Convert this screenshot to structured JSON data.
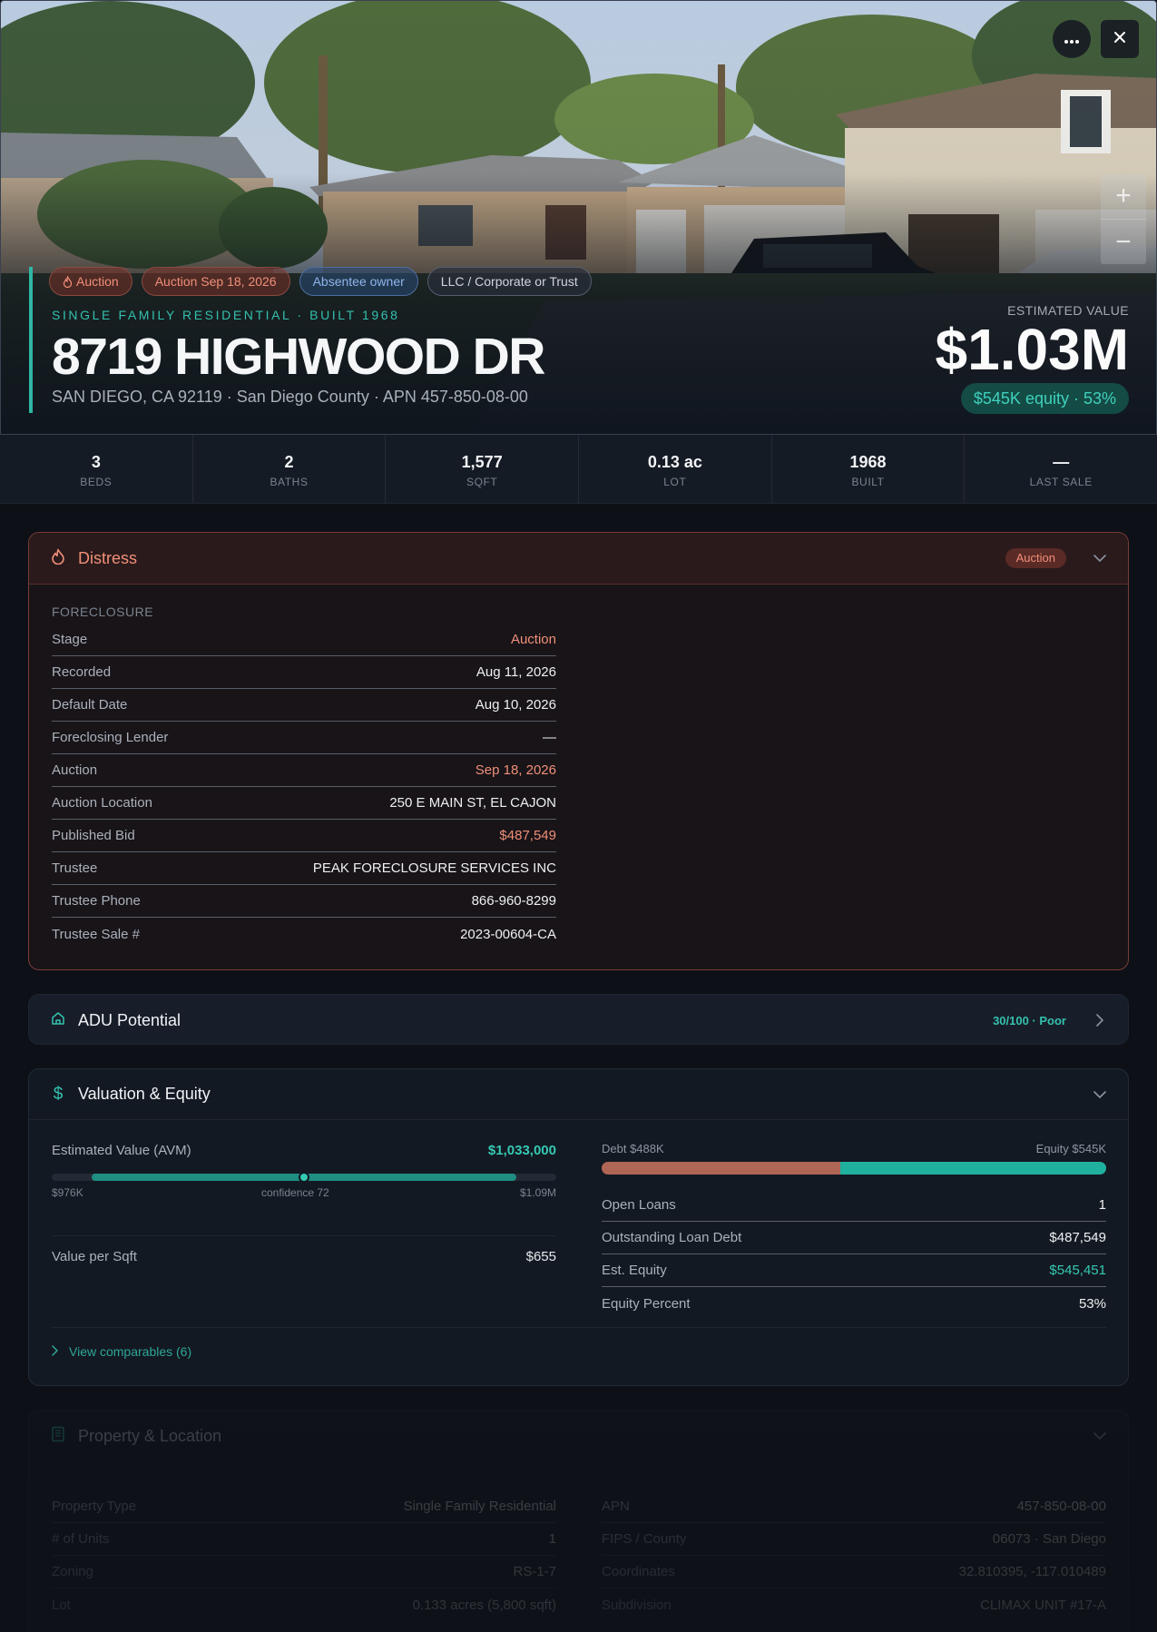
{
  "hero": {
    "tags": [
      "Auction",
      "Auction Sep 18, 2026",
      "Absentee owner",
      "LLC / Corporate or Trust"
    ],
    "type_line": "SINGLE FAMILY RESIDENTIAL · BUILT 1968",
    "address": "8719 HIGHWOOD DR",
    "sub_address": "SAN DIEGO, CA 92119 · San Diego County · APN 457-850-08-00",
    "estimated_label": "ESTIMATED VALUE",
    "estimated_value": "$1.03M",
    "equity_pill": "$545K equity · 53%",
    "more_icon": "more-horizontal-icon",
    "close_icon": "close-icon",
    "zoom_in": "+",
    "zoom_out": "−"
  },
  "stats": [
    {
      "value": "3",
      "label": "BEDS"
    },
    {
      "value": "2",
      "label": "BATHS"
    },
    {
      "value": "1,577",
      "label": "SQFT"
    },
    {
      "value": "0.13 ac",
      "label": "LOT"
    },
    {
      "value": "1968",
      "label": "BUILT"
    },
    {
      "value": "—",
      "label": "LAST SALE"
    }
  ],
  "distress": {
    "title": "Distress",
    "badge": "Auction",
    "section": "FORECLOSURE",
    "rows": [
      {
        "k": "Stage",
        "v": "Auction"
      },
      {
        "k": "Recorded",
        "v": "Aug 11, 2026"
      },
      {
        "k": "Default Date",
        "v": "Aug 10, 2026"
      },
      {
        "k": "Foreclosing Lender",
        "v": "—"
      },
      {
        "k": "Auction",
        "v": "Sep 18, 2026"
      },
      {
        "k": "Auction Location",
        "v": "250 E MAIN ST, EL CAJON"
      },
      {
        "k": "Published Bid",
        "v": "$487,549"
      },
      {
        "k": "Trustee",
        "v": "PEAK FORECLOSURE SERVICES INC"
      },
      {
        "k": "Trustee Phone",
        "v": "866-960-8299"
      },
      {
        "k": "Trustee Sale #",
        "v": "2023-00604-CA"
      }
    ]
  },
  "adu": {
    "title": "ADU Potential",
    "score": "30/100 · Poor"
  },
  "valuation": {
    "title": "Valuation & Equity",
    "avm_label": "Estimated Value (AVM)",
    "avm_value": "$1,033,000",
    "range_low": "$976K",
    "range_high": "$1.09M",
    "confidence": "confidence 72",
    "range_fill_start": 0.08,
    "range_fill_end": 0.92,
    "range_dot": 0.5,
    "vps_label": "Value per Sqft",
    "vps_value": "$655",
    "debt_label": "Debt $488K",
    "equity_label": "Equity $545K",
    "debt_fraction": 0.473,
    "rows": [
      {
        "k": "Open Loans",
        "v": "1"
      },
      {
        "k": "Outstanding Loan Debt",
        "v": "$487,549"
      },
      {
        "k": "Est. Equity",
        "v": "$545,451"
      },
      {
        "k": "Equity Percent",
        "v": "53%"
      }
    ],
    "comparables": "View comparables (6)"
  },
  "property": {
    "title": "Property & Location",
    "left_rows": [
      {
        "k": "Property Type",
        "v": "Single Family Residential"
      },
      {
        "k": "# of Units",
        "v": "1"
      },
      {
        "k": "Zoning",
        "v": "RS-1-7"
      },
      {
        "k": "Lot",
        "v": "0.133 acres (5,800 sqft)"
      }
    ],
    "right_rows": [
      {
        "k": "APN",
        "v": "457-850-08-00"
      },
      {
        "k": "FIPS / County",
        "v": "06073 · San Diego"
      },
      {
        "k": "Coordinates",
        "v": "32.810395, -117.010489"
      },
      {
        "k": "Subdivision",
        "v": "CLIMAX UNIT #17-A"
      }
    ]
  },
  "colors": {
    "accent": "#2fb6a5",
    "distress": "#f08f78",
    "owner": "#8fb5ec",
    "background": "#0d1016"
  }
}
